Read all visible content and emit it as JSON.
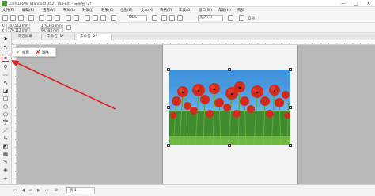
{
  "app": {
    "title": "CorelDRAW Standard 2021 (64-Bit) - 未命名 -2*",
    "window_buttons": [
      "—",
      "□",
      "✕"
    ]
  },
  "menu": [
    "文件(F)",
    "编辑(E)",
    "查看(V)",
    "布局(L)",
    "对象(J)",
    "效果(C)",
    "位图(B)",
    "文本(X)",
    "表格(T)",
    "工具(O)",
    "窗口(W)",
    "帮助(H)",
    "购买"
  ],
  "toolbar": {
    "zoom": "56%",
    "snap": "贴齐(T)",
    "launch": "启动"
  },
  "property_bar": {
    "x": "103.512 mm",
    "y": "179.112 mm",
    "w": "179.365 mm",
    "h": "90.584 mm",
    "x_label": "X:",
    "y_label": "Y:"
  },
  "tabs": [
    "欢迎屏幕",
    "未命名 -1*",
    "未命名 -2*"
  ],
  "crop_bar": {
    "crop_label": "裁剪",
    "clear_label": "清除"
  },
  "status": {
    "page_tab": "页 1"
  },
  "colors": {
    "accent": "#e02020",
    "sky": "#3d8fd6",
    "poppy": "#d42a1c",
    "stem": "#3f8a2e"
  }
}
